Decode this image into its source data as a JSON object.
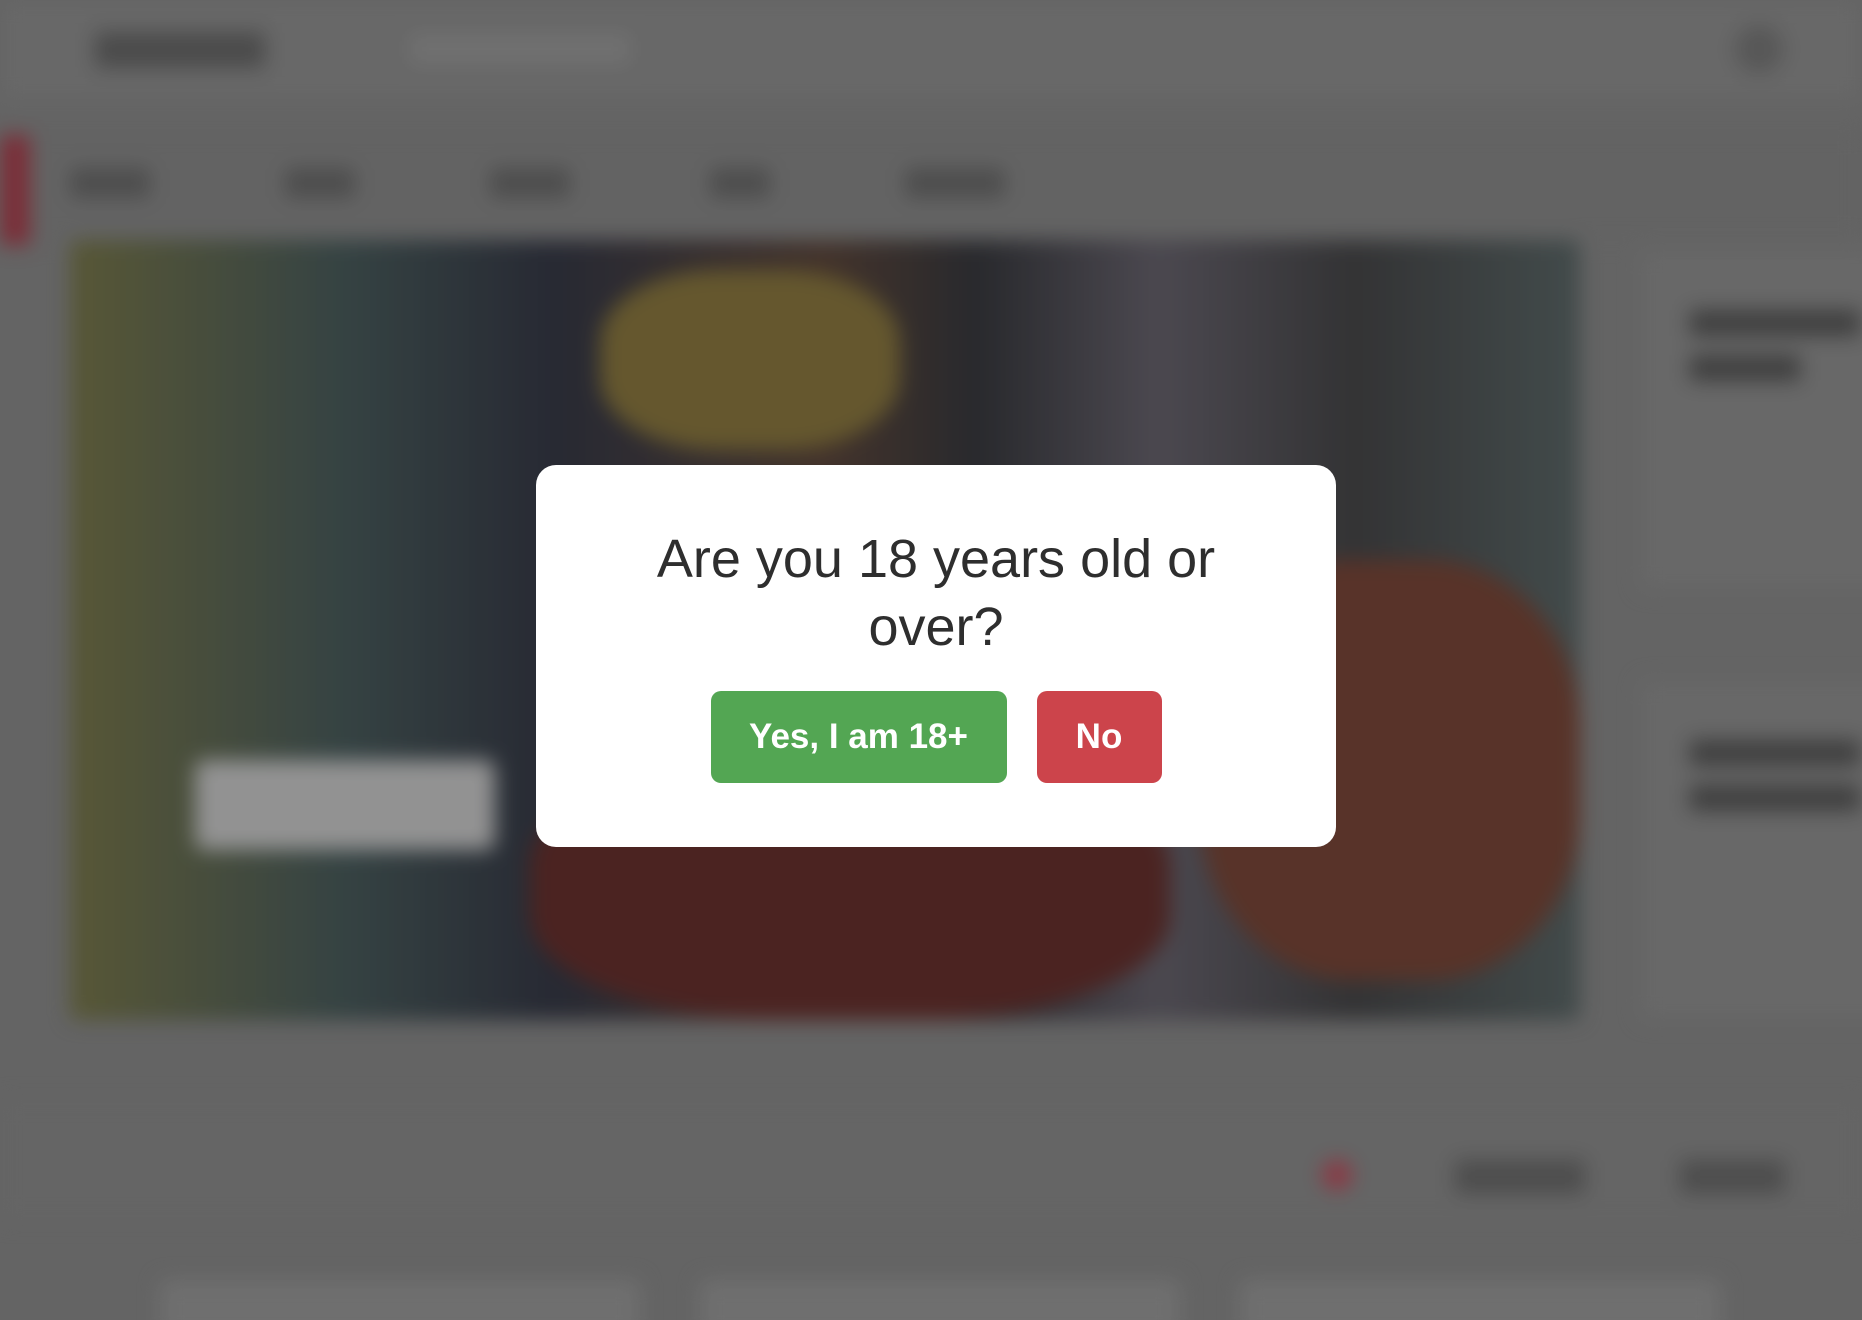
{
  "age_gate": {
    "question": "Are you 18 years old or over?",
    "confirm_label": "Yes, I am 18+",
    "deny_label": "No"
  },
  "colors": {
    "confirm_button": "#53a653",
    "deny_button": "#cc444b",
    "modal_background": "#ffffff",
    "overlay": "#6b6b6b"
  }
}
